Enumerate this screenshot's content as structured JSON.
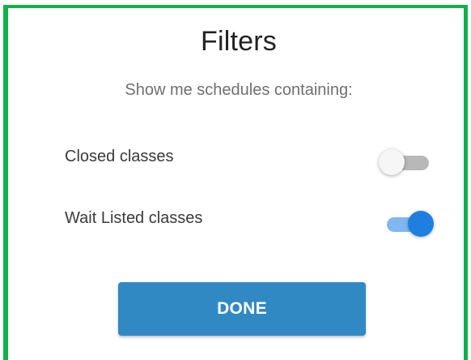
{
  "dialog": {
    "title": "Filters",
    "subtitle": "Show me schedules containing:",
    "filters": [
      {
        "label": "Closed classes",
        "enabled": false
      },
      {
        "label": "Wait Listed classes",
        "enabled": true
      }
    ],
    "done_label": "DONE"
  },
  "colors": {
    "frame_border": "#11b04a",
    "toggle_on_thumb": "#1e7fe0",
    "toggle_on_track": "#7fb7f2",
    "toggle_off_track": "#b8b8b8",
    "done_button_bg": "#3189c4"
  }
}
